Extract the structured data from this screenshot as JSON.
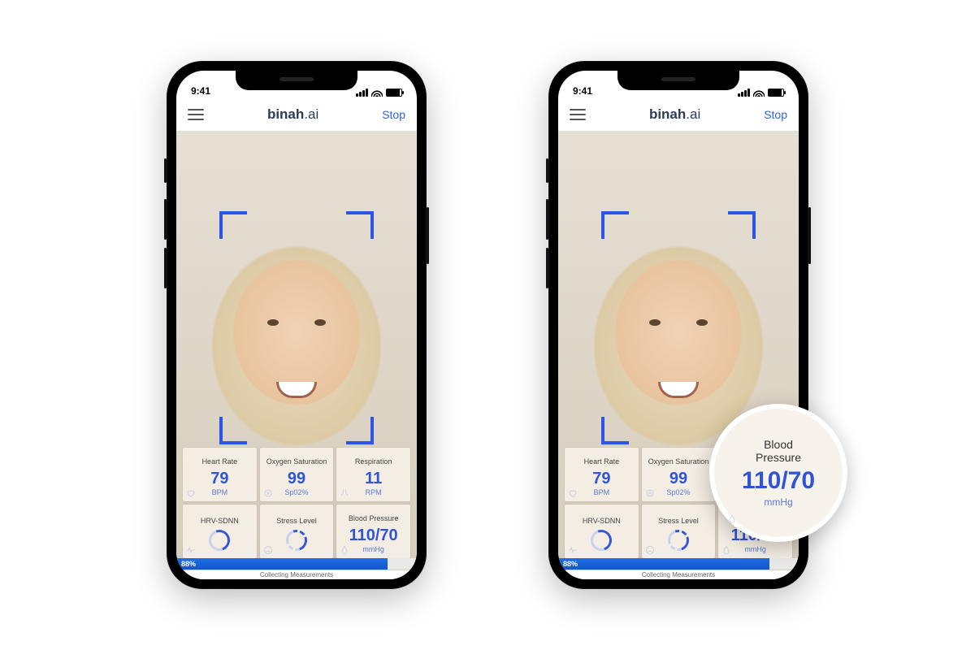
{
  "status": {
    "time": "9:41"
  },
  "appbar": {
    "brand_bold": "binah",
    "brand_rest": ".ai",
    "stop": "Stop"
  },
  "metrics": {
    "heart_rate": {
      "label": "Heart Rate",
      "value": "79",
      "unit": "BPM"
    },
    "oxygen": {
      "label": "Oxygen Saturation",
      "value": "99",
      "unit": "Sp02%"
    },
    "respiration": {
      "label": "Respiration",
      "value": "11",
      "unit": "RPM"
    },
    "hrv": {
      "label": "HRV-SDNN"
    },
    "stress": {
      "label": "Stress Level"
    },
    "blood_pressure": {
      "label": "Blood Pressure",
      "value": "110/70",
      "unit": "mmHg"
    }
  },
  "progress": {
    "percent_label": "88%",
    "percent": 88,
    "status": "Collecting Measurements"
  },
  "bubble": {
    "label_line1": "Blood",
    "label_line2": "Pressure",
    "value": "110/70",
    "unit": "mmHg"
  }
}
